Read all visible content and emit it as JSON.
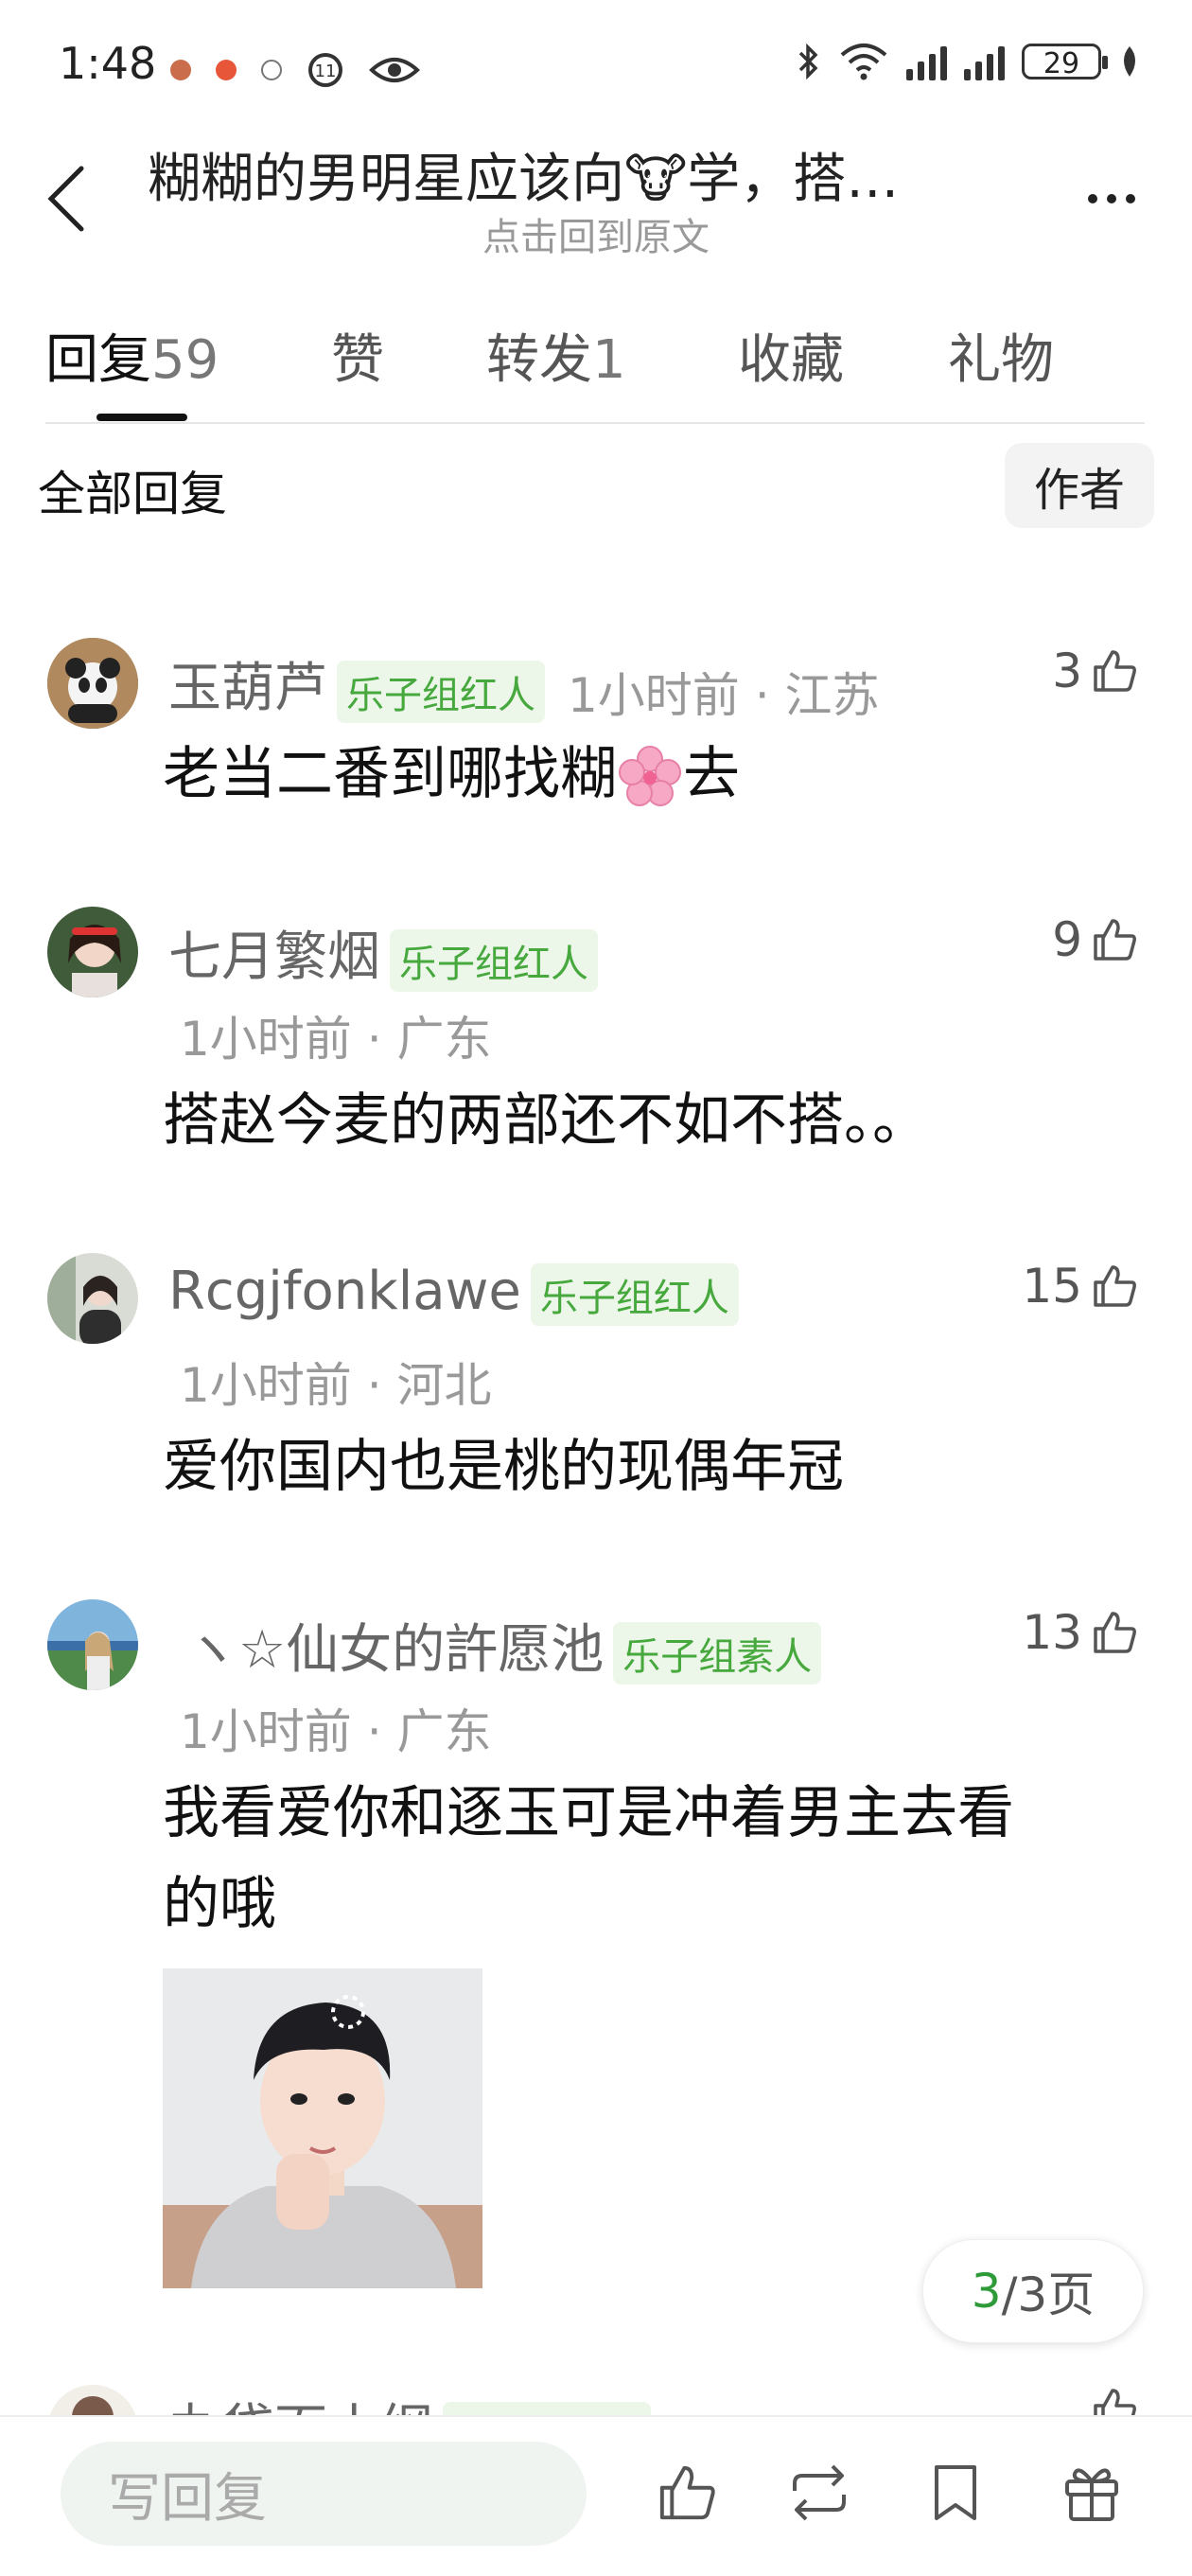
{
  "status_bar": {
    "time": "1:48",
    "battery": "29"
  },
  "header": {
    "title": "糊糊的男明星应该向🐮学，搭…",
    "subtitle": "点击回到原文"
  },
  "tabs": [
    {
      "label": "回复",
      "count": "59"
    },
    {
      "label": "赞"
    },
    {
      "label": "转发",
      "count": "1"
    },
    {
      "label": "收藏"
    },
    {
      "label": "礼物"
    }
  ],
  "filter": {
    "all_label": "全部回复",
    "author_label": "作者"
  },
  "comments": [
    {
      "name": "玉葫芦",
      "badge": "乐子组红人",
      "time": "1小时前",
      "location": "江苏",
      "likes": "3",
      "text_before": "老当二番到哪找糊",
      "text_after": "去"
    },
    {
      "name": "七月繁烟",
      "badge": "乐子组红人",
      "time": "1小时前",
      "location": "广东",
      "likes": "9",
      "text": "搭赵今麦的两部还不如不搭。。"
    },
    {
      "name": "Rcgjfonklawe",
      "badge": "乐子组红人",
      "time": "1小时前",
      "location": "河北",
      "likes": "15",
      "text": "爱你国内也是桃的现偶年冠"
    },
    {
      "name": "ヽ☆仙女的許愿池",
      "badge": "乐子组素人",
      "time": "1小时前",
      "location": "广东",
      "likes": "13",
      "text_line1": "我看爱你和逐玉可是冲着男主去看",
      "text_line2": "的哦"
    },
    {
      "name": "丸袋面小纲",
      "badge": "乐子组红人"
    }
  ],
  "pager": {
    "current": "3",
    "total": "/3页"
  },
  "bottom_bar": {
    "reply_placeholder": "写回复"
  },
  "colors": {
    "badge_green": "#46a83d",
    "badge_bg": "#ecf7ea",
    "pager_current": "#2f9a3a"
  }
}
